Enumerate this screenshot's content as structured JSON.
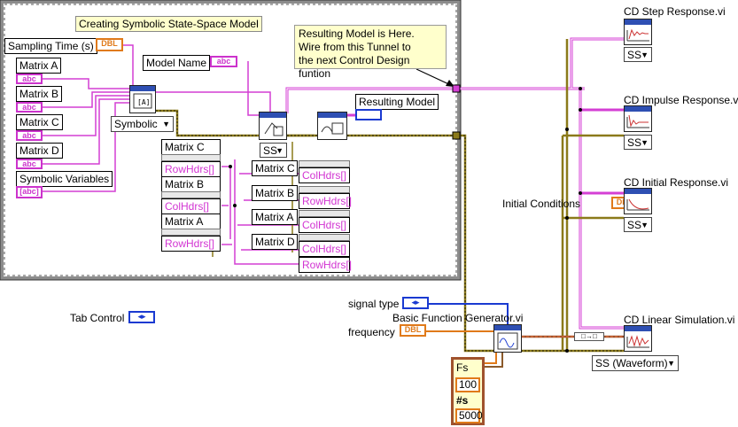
{
  "diagram": {
    "structure_label": "Creating Symbolic State-Space Model",
    "comment": [
      "Resulting Model is Here.",
      "Wire from this Tunnel to",
      "the next Control Design funtion"
    ],
    "sampling_time": {
      "label": "Sampling Time (s)",
      "type": "DBL"
    },
    "model_name": {
      "label": "Model Name",
      "type": "abc"
    },
    "matrix_inputs": [
      "Matrix A",
      "Matrix B",
      "Matrix C",
      "Matrix D"
    ],
    "string_type": "abc",
    "symbolic_variables": {
      "label": "Symbolic Variables",
      "type": "[abc]"
    },
    "symbolic_ring": "Symbolic",
    "ss_ring": "SS",
    "resulting_model": "Resulting Model",
    "left_props": [
      {
        "title": "Matrix C",
        "prop": "RowHdrs[]"
      },
      {
        "title": "Matrix B",
        "prop": "ColHdrs[]"
      },
      {
        "title": "Matrix A",
        "prop": "RowHdrs[]"
      }
    ],
    "right_props": [
      {
        "title": "Matrix C",
        "prop": "ColHdrs[]"
      },
      {
        "title": "Matrix B",
        "prop": "RowHdrs[]"
      },
      {
        "title": "Matrix A",
        "prop": "ColHdrs[]"
      },
      {
        "title": "Matrix D",
        "props": [
          "ColHdrs[]",
          "RowHdrs[]"
        ]
      }
    ],
    "tab_control": "Tab Control",
    "signal_type": "signal type",
    "frequency": {
      "label": "frequency",
      "type": "DBL"
    },
    "generator": "Basic Function Generator.vi",
    "fs_cluster": {
      "fs_label": "Fs",
      "fs_value": "100",
      "n_label": "#s",
      "n_value": "5000"
    },
    "initial_conditions": {
      "label": "Initial Conditions",
      "type": "DBL"
    },
    "subvis": [
      {
        "title": "CD Step Response.vi",
        "ring": "SS"
      },
      {
        "title": "CD Impulse Response.vi",
        "ring": "SS"
      },
      {
        "title": "CD Initial Response.vi",
        "ring": "SS"
      },
      {
        "title": "CD Linear Simulation.vi",
        "ring": "SS (Waveform)"
      }
    ]
  },
  "colors": {
    "frame": "#8c8c8c",
    "string_wire": "#d43fd4",
    "numeric_wire": "#e07a1a",
    "cluster_wire": "#8b6b1a",
    "waveform_wire": "#a0522d",
    "enum_wire": "#1a3ad1",
    "label_bg": "#ffffcc"
  }
}
